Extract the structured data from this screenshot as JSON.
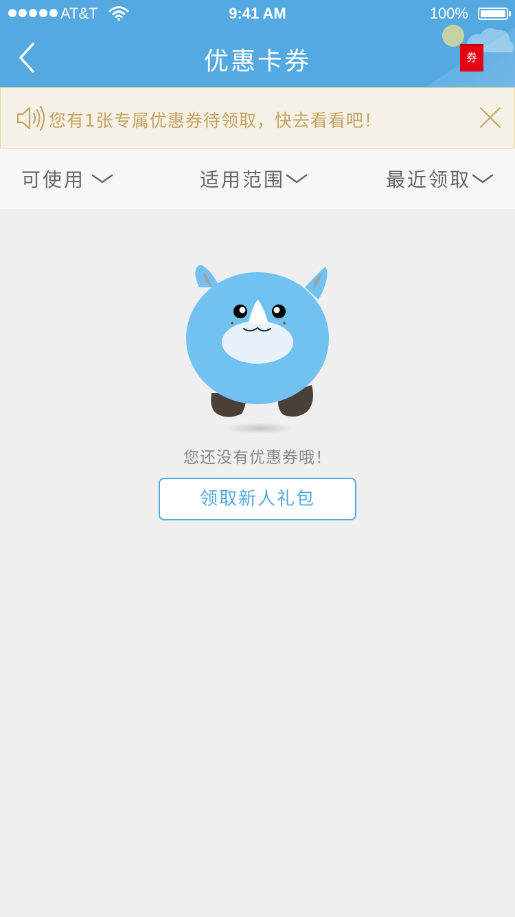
{
  "status_bar": {
    "carrier": "AT&T",
    "time": "9:41 AM",
    "battery": "100%"
  },
  "nav": {
    "title": "优惠卡券",
    "coupon_tag": "券"
  },
  "notice": {
    "text": "您有1张专属优惠券待领取，快去看看吧！"
  },
  "filters": [
    {
      "label": "可使用"
    },
    {
      "label": "适用范围"
    },
    {
      "label": "最近领取"
    }
  ],
  "empty_state": {
    "message": "您还没有优惠券哦！",
    "button_label": "领取新人礼包"
  },
  "colors": {
    "header": "#55a9e1",
    "notice_text": "#c6a361",
    "coupon_tag": "#e60012",
    "mascot_body": "#72c2f1"
  }
}
